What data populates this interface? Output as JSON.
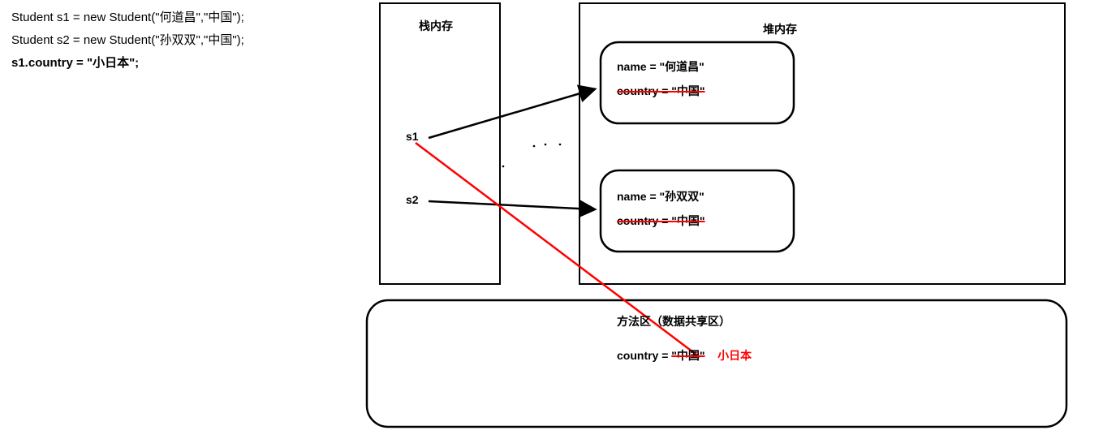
{
  "code": {
    "line1": "Student s1 = new Student(\"何道昌\",\"中国\");",
    "line2": "Student s2 = new Student(\"孙双双\",\"中国\");",
    "line3": "s1.country = \"小日本\";"
  },
  "stack": {
    "title": "栈内存",
    "var1": "s1",
    "var2": "s2"
  },
  "heap": {
    "title": "堆内存",
    "obj1": {
      "name_label": "name = \"何道昌\"",
      "country_label": "country = \"中国\""
    },
    "obj2": {
      "name_label": "name = \"孙双双\"",
      "country_label": "country  = \"中国\""
    }
  },
  "method_area": {
    "title": "方法区（数据共享区）",
    "country_key": "country =",
    "country_old": "\"中国\"",
    "country_new": "小日本"
  }
}
